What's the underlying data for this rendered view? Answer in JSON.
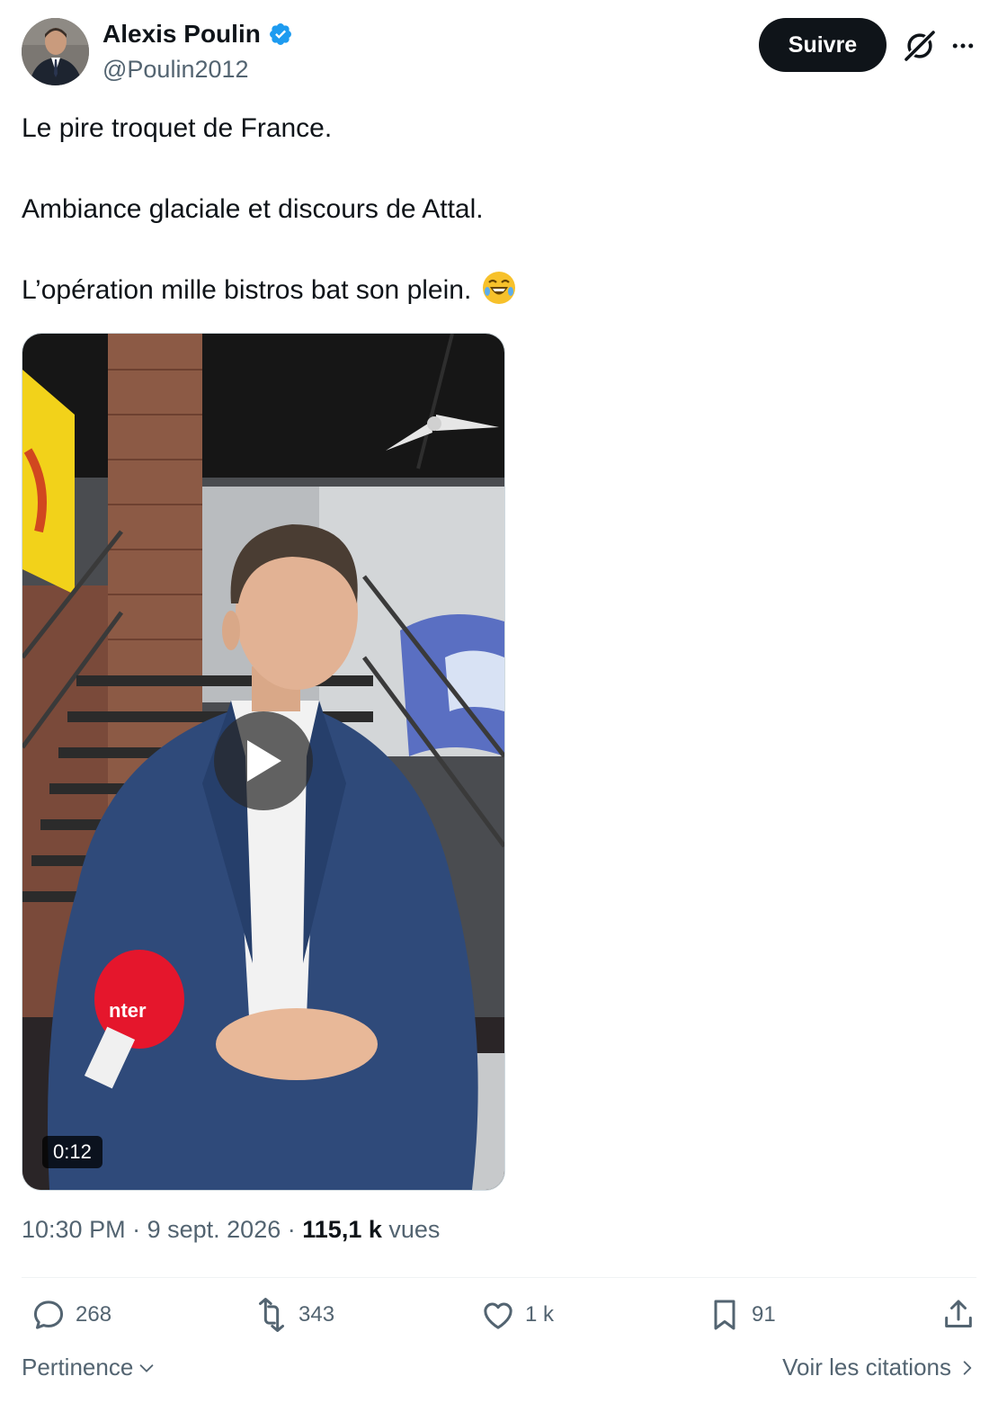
{
  "author": {
    "name": "Alexis Poulin",
    "handle": "@Poulin2012",
    "verified": true
  },
  "header": {
    "follow_label": "Suivre"
  },
  "tweet": {
    "lines": [
      "Le pire troquet de France.",
      "Ambiance glaciale et discours de Attal.",
      "L’opération mille bistros bat son plein."
    ],
    "emoji": "rolling-on-floor-laughing"
  },
  "media": {
    "type": "video",
    "duration": "0:12",
    "mic_text": "nter"
  },
  "meta": {
    "time": "10:30 PM",
    "sep": "·",
    "date": "9 sept. 2026",
    "views_count": "115,1 k",
    "views_label": "vues"
  },
  "actions": {
    "replies": "268",
    "reposts": "343",
    "likes": "1 k",
    "bookmarks": "91"
  },
  "footer": {
    "sort_label": "Pertinence",
    "quotes_label": "Voir les citations"
  },
  "colors": {
    "primary_text": "#0f1419",
    "secondary_text": "#536471",
    "verified_blue": "#1d9bf0",
    "button_bg": "#0f1419"
  }
}
